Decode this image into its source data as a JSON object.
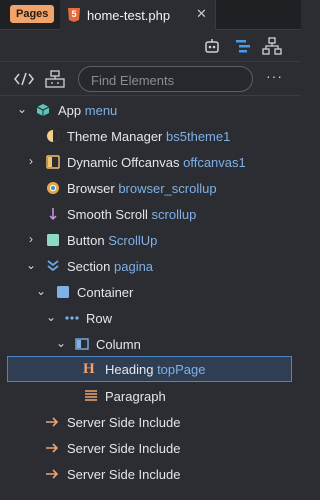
{
  "tabbar": {
    "badge": "Pages",
    "file_name": "home-test.php",
    "close": "✕"
  },
  "toolbar": {
    "search_placeholder": "Find Elements",
    "more": "···"
  },
  "tree": [
    {
      "label": "App",
      "id": "menu",
      "icon": "app-cube-icon",
      "expanded": true
    },
    {
      "label": "Theme Manager",
      "id": "bs5theme1",
      "icon": "theme-manager-icon"
    },
    {
      "label": "Dynamic Offcanvas",
      "id": "offcanvas1",
      "icon": "offcanvas-icon",
      "collapsed": true
    },
    {
      "label": "Browser",
      "id": "browser_scrollup",
      "icon": "browser-icon"
    },
    {
      "label": "Smooth Scroll",
      "id": "scrollup",
      "icon": "smooth-scroll-icon"
    },
    {
      "label": "Button",
      "id": "ScrollUp",
      "icon": "button-icon",
      "collapsed": true
    },
    {
      "label": "Section",
      "id": "pagina",
      "icon": "section-icon",
      "expanded": true
    },
    {
      "label": "Container",
      "id": "",
      "icon": "container-icon",
      "expanded": true
    },
    {
      "label": "Row",
      "id": "",
      "icon": "row-icon",
      "expanded": true
    },
    {
      "label": "Column",
      "id": "",
      "icon": "column-icon",
      "expanded": true
    },
    {
      "label": "Heading",
      "id": "topPage",
      "icon": "heading-icon",
      "selected": true
    },
    {
      "label": "Paragraph",
      "id": "",
      "icon": "paragraph-icon"
    },
    {
      "label": "Server Side Include",
      "id": "",
      "icon": "server-include-icon"
    },
    {
      "label": "Server Side Include",
      "id": "",
      "icon": "server-include-icon"
    },
    {
      "label": "Server Side Include",
      "id": "",
      "icon": "server-include-icon"
    }
  ],
  "colors": {
    "accent": "#f0a36a",
    "id_text": "#7fb0e6",
    "selected_bg": "#2f3e52",
    "selected_border": "#4b86c4"
  }
}
